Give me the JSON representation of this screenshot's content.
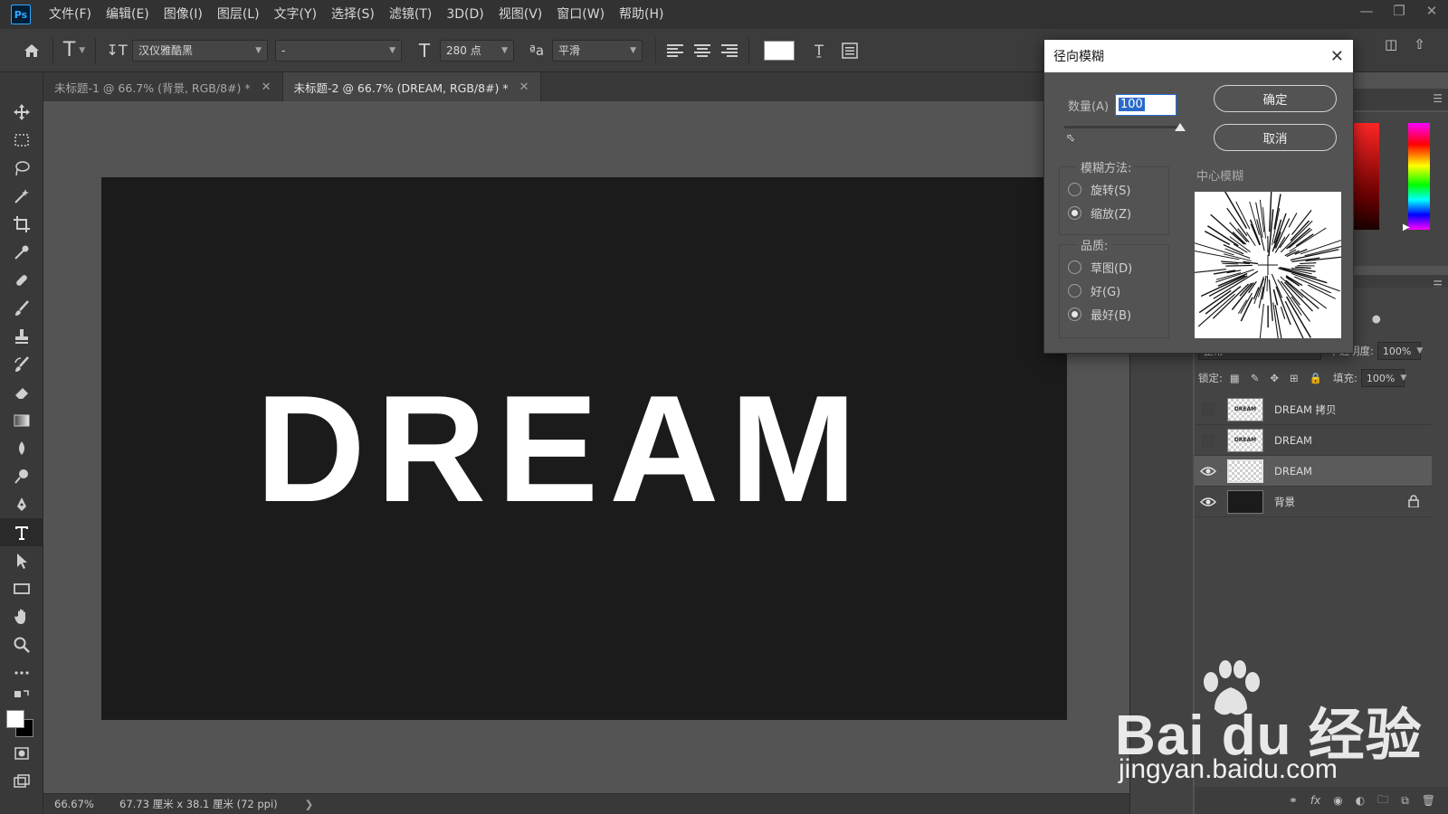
{
  "menubar": {
    "logo": "Ps",
    "items": [
      "文件(F)",
      "编辑(E)",
      "图像(I)",
      "图层(L)",
      "文字(Y)",
      "选择(S)",
      "滤镜(T)",
      "3D(D)",
      "视图(V)",
      "窗口(W)",
      "帮助(H)"
    ]
  },
  "options": {
    "font_family": "汉仪雅酷黑",
    "font_style": "-",
    "font_size": "280 点",
    "antialias": "平滑",
    "text_color": "#ffffff"
  },
  "tabs": [
    {
      "label": "未标题-1 @ 66.7% (背景, RGB/8#) *",
      "active": false
    },
    {
      "label": "未标题-2 @ 66.7% (DREAM, RGB/8#) *",
      "active": true
    }
  ],
  "canvas": {
    "text": "DREAM",
    "background": "#1b1b1b",
    "text_color": "#ffffff"
  },
  "status": {
    "zoom": "66.67%",
    "doc_info": "67.73 厘米 x 38.1 厘米 (72 ppi)"
  },
  "layers": {
    "blend_mode": "正常",
    "opacity_label": "不透明度:",
    "opacity": "100%",
    "lock_label": "锁定:",
    "fill_label": "填充:",
    "fill": "100%",
    "items": [
      {
        "name": "DREAM 拷贝",
        "visible": false,
        "selected": false
      },
      {
        "name": "DREAM",
        "visible": false,
        "selected": false
      },
      {
        "name": "DREAM",
        "visible": true,
        "selected": true
      },
      {
        "name": "背景",
        "visible": true,
        "selected": false,
        "locked": true
      }
    ]
  },
  "dialog": {
    "title": "径向模糊",
    "amount_label": "数量(A)",
    "amount_value": "100",
    "ok_label": "确定",
    "cancel_label": "取消",
    "method_title": "模糊方法:",
    "method_options": [
      {
        "label": "旋转(S)",
        "checked": false
      },
      {
        "label": "缩放(Z)",
        "checked": true
      }
    ],
    "quality_title": "品质:",
    "quality_options": [
      {
        "label": "草图(D)",
        "checked": false
      },
      {
        "label": "好(G)",
        "checked": false
      },
      {
        "label": "最好(B)",
        "checked": true
      }
    ],
    "blur_center_label": "中心模糊"
  },
  "watermark": {
    "brand": "Bai du 经验",
    "url": "jingyan.baidu.com"
  }
}
